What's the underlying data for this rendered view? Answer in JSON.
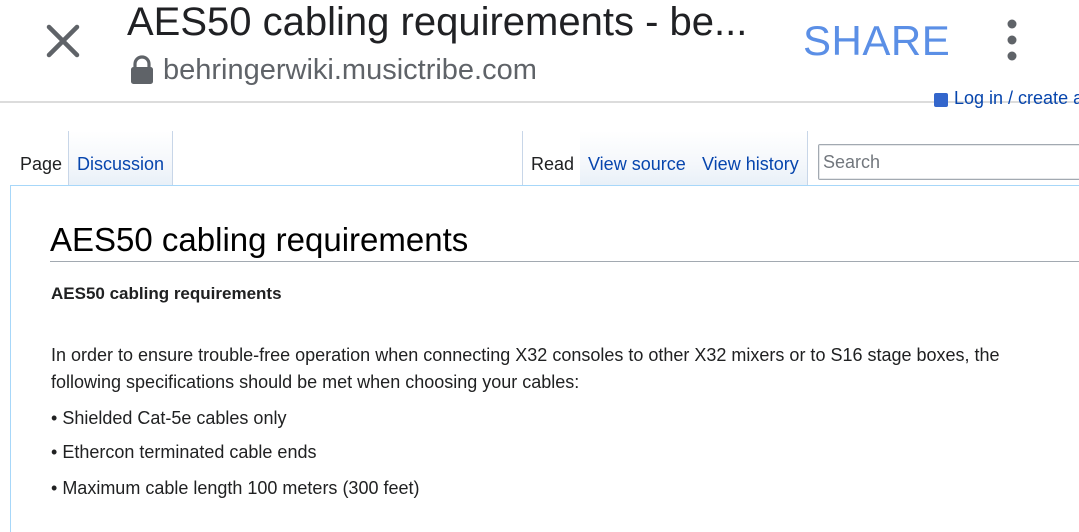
{
  "browser": {
    "title": "AES50 cabling requirements - be...",
    "url": "behringerwiki.musictribe.com",
    "share_label": "SHARE",
    "icons": {
      "close": "close-icon",
      "lock": "lock-icon",
      "overflow": "more-vert-icon"
    },
    "colors": {
      "share": "#5b8fe6"
    }
  },
  "wiki": {
    "personal_tools_label": "Log in / create ac",
    "tabs_left": [
      {
        "label": "Page",
        "selected": true
      },
      {
        "label": "Discussion",
        "selected": false
      }
    ],
    "tabs_right": [
      {
        "label": "Read",
        "selected": true
      },
      {
        "label": "View source",
        "selected": false
      },
      {
        "label": "View history",
        "selected": false
      }
    ],
    "search": {
      "placeholder": "Search",
      "value": ""
    },
    "colors": {
      "link": "#0645ad",
      "border": "#a7d7f9"
    }
  },
  "article": {
    "heading": "AES50 cabling requirements",
    "bold_line": "AES50 cabling requirements",
    "intro": "In order to ensure trouble-free operation when connecting X32 consoles to other X32 mixers or to S16 stage boxes, the following specifications should be met when choosing your cables:",
    "bullets": [
      "Shielded Cat-5e cables only",
      "Ethercon terminated cable ends",
      "Maximum cable length 100 meters (300 feet)"
    ]
  }
}
